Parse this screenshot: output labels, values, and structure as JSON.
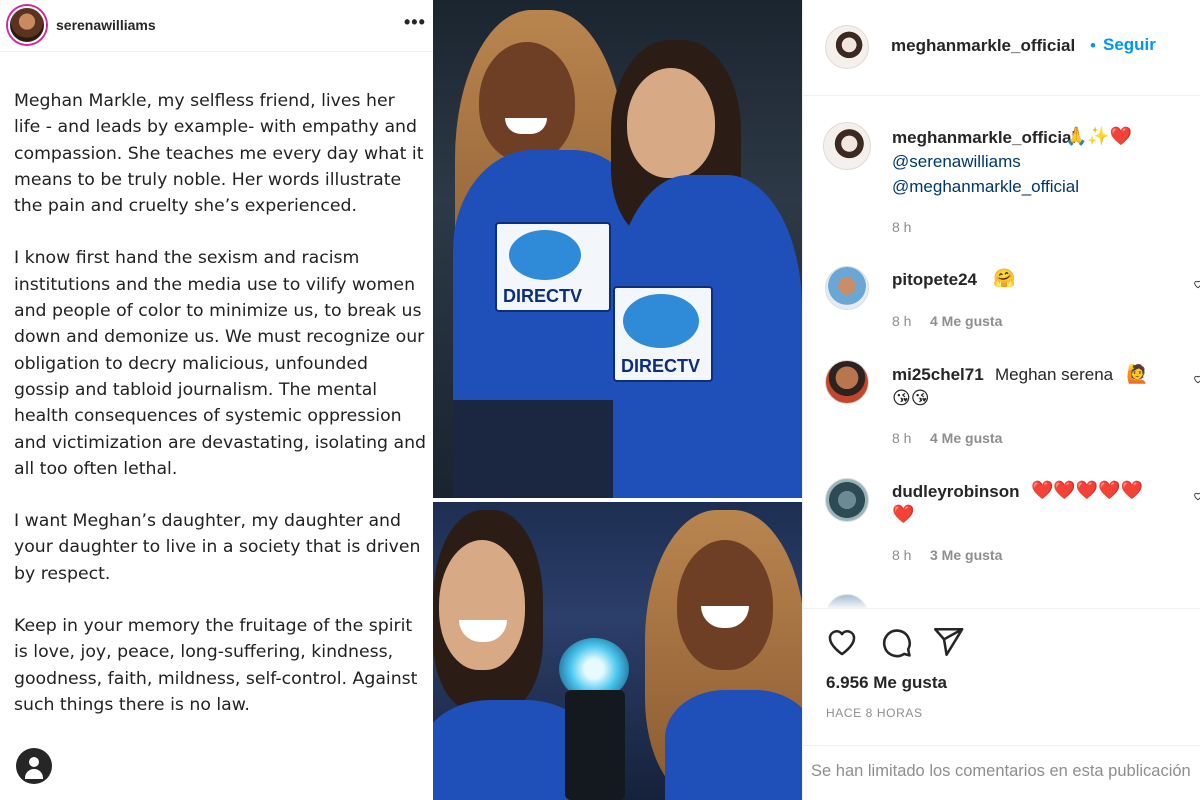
{
  "left_post": {
    "username": "serenawilliams",
    "more_label": "•••",
    "paragraphs": [
      "Meghan Markle, my selfless friend, lives her life - and leads by example- with empathy and compassion. She teaches me every day what it means to be truly noble. Her words illustrate the pain and cruelty she’s experienced.",
      "I know first hand the sexism and racism institutions and the media use to vilify women and people of color to minimize us, to break us down and demonize us. We must recognize our obligation to decry malicious, unfounded gossip and tabloid journalism. The mental health consequences of systemic oppression and victimization are devastating, isolating and all too often lethal.",
      "I want Meghan’s daughter, my daughter and your daughter to live in a society that is driven by respect.",
      "Keep in your memory the fruitage of the spirit is love, joy, peace, long-suffering, kindness, goodness, faith,  mildness, self-control. Against such things there is no law."
    ]
  },
  "photos": {
    "logo_text_top_left": "DIRECTV",
    "logo_text_top_right": "DIRECTV"
  },
  "right_panel": {
    "header": {
      "username": "meghanmarkle_official",
      "dot": "•",
      "follow_label": "Seguir"
    },
    "caption": {
      "username": "meghanmarkle_official",
      "emoji": "🙏✨❤️",
      "mention_1": "@serenawilliams",
      "mention_2": "@meghanmarkle_official",
      "time": "8 h"
    },
    "comments": [
      {
        "username": "pitopete24",
        "text": "",
        "emoji": "🤗",
        "time": "8 h",
        "likes": "4 Me gusta"
      },
      {
        "username": "mi25chel71",
        "text": "Meghan serena",
        "emoji": "🙋",
        "emoji_line2": "😘😘",
        "time": "8 h",
        "likes": "4 Me gusta"
      },
      {
        "username": "dudleyrobinson",
        "text": "",
        "emoji": "❤️❤️❤️❤️❤️",
        "emoji_line2": "❤️",
        "time": "8 h",
        "likes": "3 Me gusta"
      }
    ],
    "likes_count": "6.956 Me gusta",
    "posted_ago": "HACE 8 HORAS",
    "comments_limited": "Se han limitado los comentarios en esta publicación"
  },
  "colors": {
    "link_blue": "#0095f6",
    "mention_blue": "#00376b",
    "muted_gray": "#8e8e8e",
    "shirt_blue": "#1f4fb8"
  },
  "icons": [
    "more-options-icon",
    "user-icon",
    "heart-icon",
    "comment-icon",
    "share-icon",
    "comment-like-heart-icon"
  ]
}
